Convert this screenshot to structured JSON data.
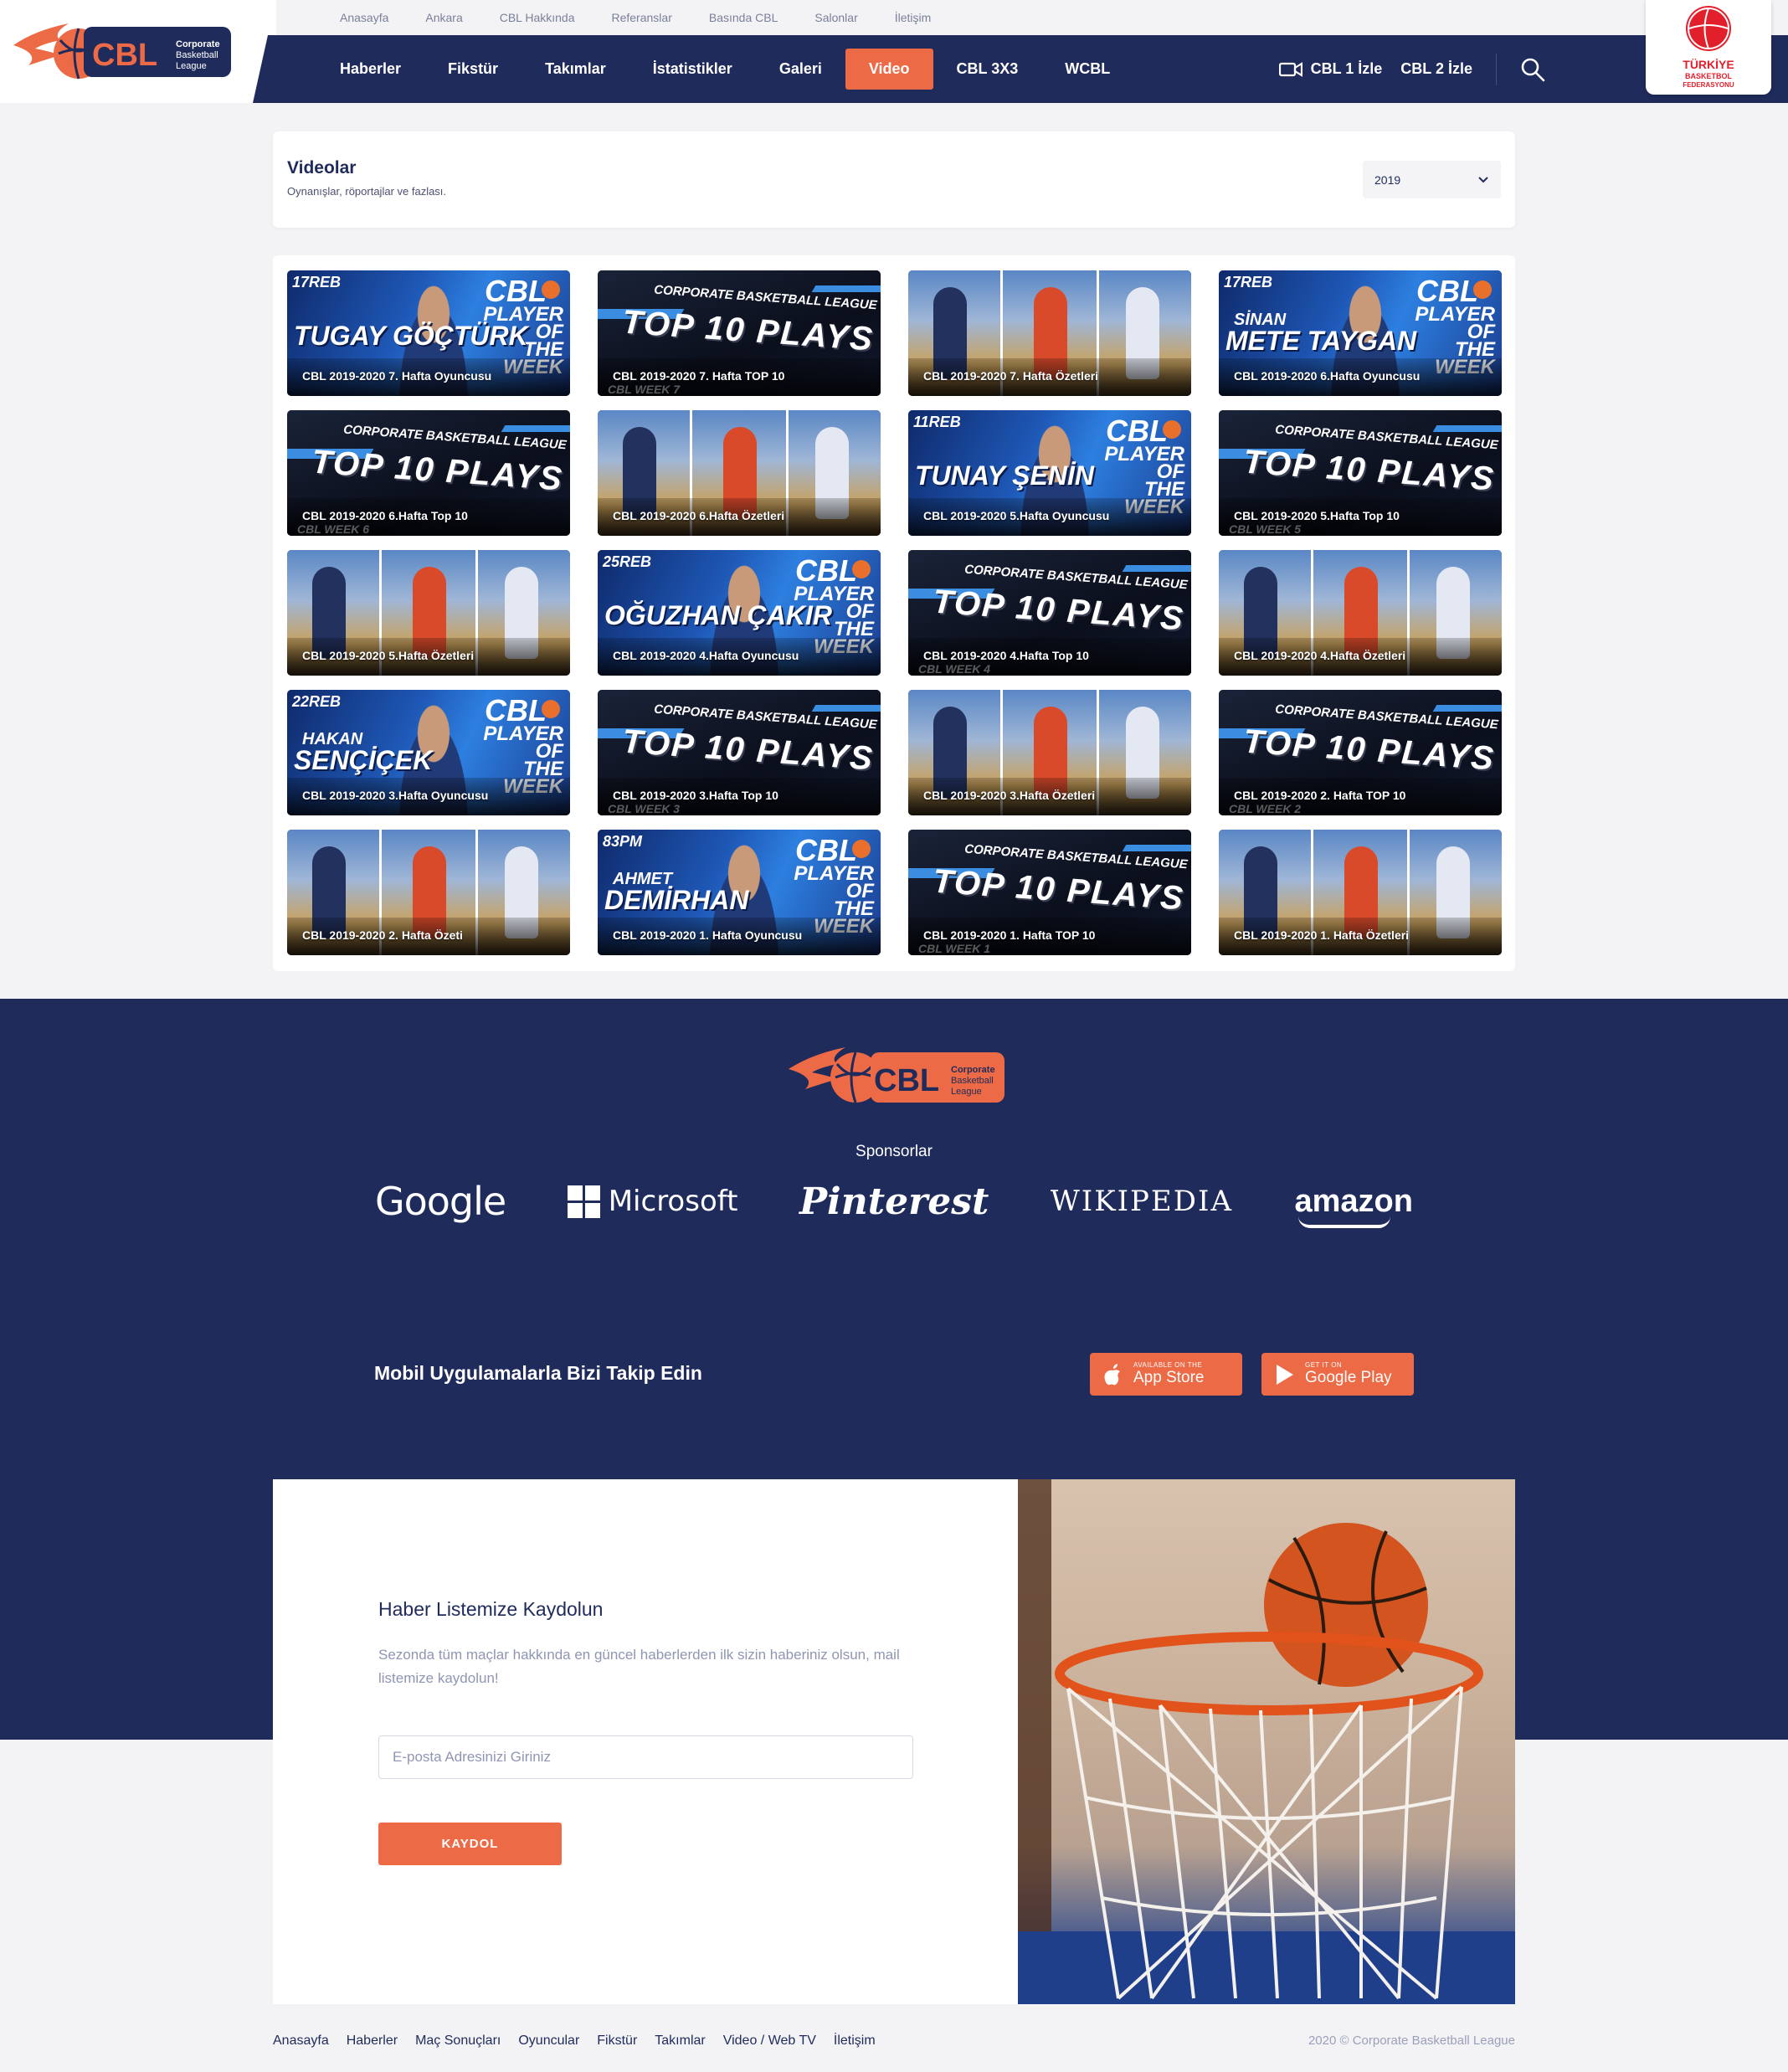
{
  "brand": {
    "logo_text": "CBL",
    "logo_sub": [
      "Corporate",
      "Basketball",
      "League"
    ],
    "federation_text": [
      "TÜRKİYE",
      "BASKETBOL",
      "FEDERASYONU"
    ]
  },
  "top_links": [
    "Anasayfa",
    "Ankara",
    "CBL Hakkında",
    "Referanslar",
    "Basında CBL",
    "Salonlar",
    "İletişim"
  ],
  "main_nav": [
    "Haberler",
    "Fikstür",
    "Takımlar",
    "İstatistikler",
    "Galeri",
    "Video",
    "CBL 3X3",
    "WCBL"
  ],
  "main_nav_active": "Video",
  "live": [
    "CBL 1 İzle",
    "CBL 2 İzle"
  ],
  "page": {
    "title": "Videolar",
    "subtitle": "Oynanışlar, röportajlar ve fazlası.",
    "year": "2019"
  },
  "videos": [
    {
      "type": "player",
      "title": "CBL 2019-2020 7. Hafta Oyuncusu",
      "stat": "17REB",
      "first": "",
      "last": "TUGAY GÖÇTÜRK"
    },
    {
      "type": "top",
      "title": "CBL 2019-2020 7. Hafta TOP 10",
      "week": "CBL WEEK 7"
    },
    {
      "type": "high",
      "title": "CBL 2019-2020 7. Hafta Özetleri"
    },
    {
      "type": "player",
      "title": "CBL 2019-2020 6.Hafta Oyuncusu",
      "stat": "17REB",
      "first": "SİNAN",
      "last": "METE TAYGAN"
    },
    {
      "type": "top",
      "title": "CBL 2019-2020 6.Hafta Top 10",
      "week": "CBL WEEK 6"
    },
    {
      "type": "high",
      "title": "CBL 2019-2020 6.Hafta Özetleri"
    },
    {
      "type": "player",
      "title": "CBL 2019-2020 5.Hafta Oyuncusu",
      "stat": "11REB",
      "first": "",
      "last": "TUNAY ŞENİN"
    },
    {
      "type": "top",
      "title": "CBL 2019-2020 5.Hafta Top 10",
      "week": "CBL WEEK 5"
    },
    {
      "type": "high",
      "title": "CBL 2019-2020 5.Hafta Özetleri"
    },
    {
      "type": "player",
      "title": "CBL 2019-2020 4.Hafta Oyuncusu",
      "stat": "25REB",
      "first": "",
      "last": "OĞUZHAN ÇAKIR"
    },
    {
      "type": "top",
      "title": "CBL 2019-2020 4.Hafta Top 10",
      "week": "CBL WEEK 4"
    },
    {
      "type": "high",
      "title": "CBL 2019-2020 4.Hafta Özetleri"
    },
    {
      "type": "player",
      "title": "CBL 2019-2020 3.Hafta Oyuncusu",
      "stat": "22REB",
      "first": "HAKAN",
      "last": "SENÇİÇEK"
    },
    {
      "type": "top",
      "title": "CBL 2019-2020 3.Hafta Top 10",
      "week": "CBL WEEK 3"
    },
    {
      "type": "high",
      "title": "CBL 2019-2020 3.Hafta Özetleri"
    },
    {
      "type": "top",
      "title": "CBL 2019-2020 2. Hafta TOP 10",
      "week": "CBL WEEK 2"
    },
    {
      "type": "high",
      "title": "CBL 2019-2020 2. Hafta Özeti"
    },
    {
      "type": "player",
      "title": "CBL 2019-2020 1. Hafta Oyuncusu",
      "stat": "83PM",
      "first": "AHMET",
      "last": "DEMİRHAN"
    },
    {
      "type": "top",
      "title": "CBL 2019-2020 1. Hafta TOP 10",
      "week": "CBL WEEK 1"
    },
    {
      "type": "high",
      "title": "CBL 2019-2020 1. Hafta Özetleri"
    }
  ],
  "thumb_text": {
    "player_of_the_week": [
      "PLAYER",
      "OF",
      "THE",
      "WEEK"
    ],
    "league": "CORPORATE BASKETBALL LEAGUE",
    "top10": "TOP 10 PLAYS"
  },
  "sponsors": {
    "label": "Sponsorlar",
    "items": [
      "Google",
      "Microsoft",
      "Pinterest",
      "Wikipedia",
      "amazon"
    ]
  },
  "mobile": {
    "title": "Mobil Uygulamalarla Bizi Takip Edin",
    "apple_small": "AVAILABLE ON THE",
    "apple_big": "App Store",
    "play_small": "GET IT ON",
    "play_big": "Google Play"
  },
  "newsletter": {
    "title": "Haber Listemize Kaydolun",
    "text": "Sezonda tüm maçlar hakkında en güncel haberlerden ilk sizin haberiniz olsun, mail listemize kaydolun!",
    "placeholder": "E-posta Adresinizi Giriniz",
    "button": "KAYDOL"
  },
  "footer": {
    "links": [
      "Anasayfa",
      "Haberler",
      "Maç Sonuçları",
      "Oyuncular",
      "Fikstür",
      "Takımlar",
      "Video / Web TV",
      "İletişim"
    ],
    "copyright": "2020 © Corporate Basketball League"
  },
  "colors": {
    "navy": "#1f2b5b",
    "accent": "#ec6a45"
  }
}
